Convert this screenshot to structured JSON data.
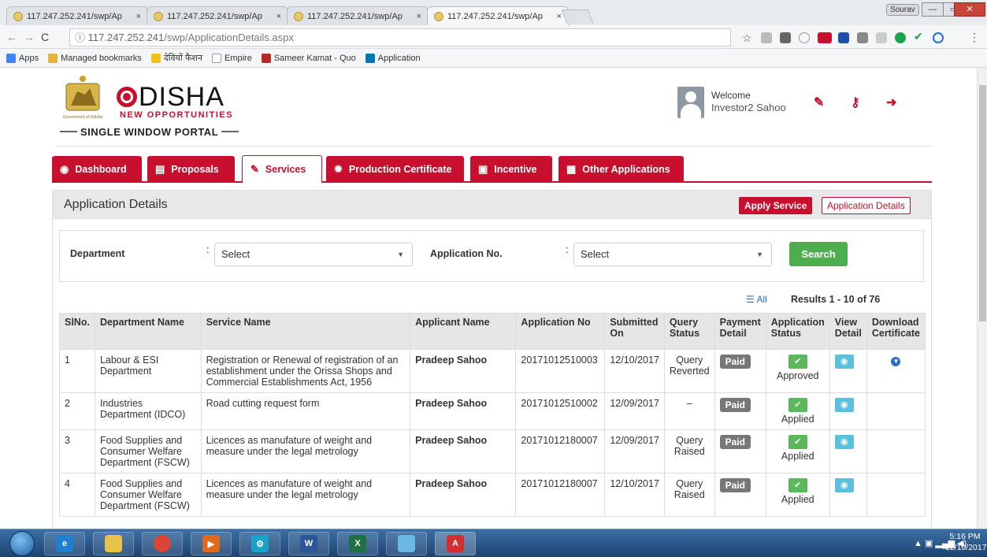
{
  "browser": {
    "tabs": [
      {
        "title": "117.247.252.241/swp/Ap",
        "close": "×"
      },
      {
        "title": "117.247.252.241/swp/Ap",
        "close": "×"
      },
      {
        "title": "117.247.252.241/swp/Ap",
        "close": "×"
      },
      {
        "title": "117.247.252.241/swp/Ap",
        "close": "×"
      }
    ],
    "user_chip": "Sourav",
    "window_controls": {
      "minimize": "—",
      "maximize": "▭",
      "close": "✕"
    },
    "url_prefix": "117.247.252.241",
    "url_path": "/swp/ApplicationDetails.aspx",
    "bookmarks": [
      {
        "label": "Apps",
        "icon": "apps-grid-icon",
        "color": "#4285f4"
      },
      {
        "label": "Managed bookmarks",
        "icon": "folder-icon",
        "color": "#e8b33c"
      },
      {
        "label": "देवियों फैशन",
        "icon": "fashion-icon",
        "color": "#f2c21b"
      },
      {
        "label": "Empire",
        "icon": "page-icon",
        "color": "#cccccc"
      },
      {
        "label": "Sameer Kamat - Quo",
        "icon": "quora-icon",
        "color": "#b92b27"
      },
      {
        "label": "Application",
        "icon": "linkedin-icon",
        "color": "#0077b5"
      }
    ]
  },
  "header": {
    "emblem_caption": "Government of Odisha",
    "logo_text": "DISHA",
    "logo_sub": "NEW OPPORTUNITIES",
    "portal": "SINGLE WINDOW PORTAL",
    "welcome": "Welcome",
    "user_name": "Investor2 Sahoo"
  },
  "nav": {
    "tabs": [
      {
        "label": "Dashboard",
        "icon": "dashboard-icon",
        "glyph": "◉"
      },
      {
        "label": "Proposals",
        "icon": "briefcase-icon",
        "glyph": "▤"
      },
      {
        "label": "Services",
        "icon": "wrench-icon",
        "glyph": "✎"
      },
      {
        "label": "Production Certificate",
        "icon": "certificate-icon",
        "glyph": "✹"
      },
      {
        "label": "Incentive",
        "icon": "money-icon",
        "glyph": "▣"
      },
      {
        "label": "Other Applications",
        "icon": "grid-icon",
        "glyph": "▦"
      }
    ]
  },
  "panel": {
    "title": "Application Details",
    "apply_service": "Apply Service",
    "application_details": "Application Details"
  },
  "filters": {
    "department_label": "Department",
    "department_value": "Select",
    "appno_label": "Application No.",
    "appno_value": "Select",
    "colon": ":",
    "search_label": "Search",
    "all_label": "All",
    "results": "Results 1 - 10 of 76"
  },
  "table": {
    "headers": [
      "SlNo.",
      "Department Name",
      "Service Name",
      "Applicant Name",
      "Application No",
      "Submitted On",
      "Query Status",
      "Payment Detail",
      "Application Status",
      "View Detail",
      "Download Certificate"
    ],
    "rows": [
      {
        "sl": "1",
        "dept": "Labour & ESI Department",
        "service": "Registration or Renewal of registration of an establishment under the Orissa Shops and Commercial Establishments Act, 1956",
        "applicant": "Pradeep Sahoo",
        "appno": "20171012510003",
        "submitted": "12/10/2017",
        "query": "Query Reverted",
        "payment": "Paid",
        "status": "Approved",
        "has_download": true
      },
      {
        "sl": "2",
        "dept": "Industries Department (IDCO)",
        "service": "Road cutting request form",
        "applicant": "Pradeep Sahoo",
        "appno": "20171012510002",
        "submitted": "12/09/2017",
        "query": "–",
        "payment": "Paid",
        "status": "Applied",
        "has_download": false
      },
      {
        "sl": "3",
        "dept": "Food Supplies and Consumer Welfare Department (FSCW)",
        "service": "Licences as manufature of weight and measure under the legal metrology",
        "applicant": "Pradeep Sahoo",
        "appno": "20171012180007",
        "submitted": "12/09/2017",
        "query": "Query Raised",
        "payment": "Paid",
        "status": "Applied",
        "has_download": false
      },
      {
        "sl": "4",
        "dept": "Food Supplies and Consumer Welfare Department (FSCW)",
        "service": "Licences as manufature of weight and measure under the legal metrology",
        "applicant": "Pradeep Sahoo",
        "appno": "20171012180007",
        "submitted": "12/10/2017",
        "query": "Query Raised",
        "payment": "Paid",
        "status": "Applied",
        "has_download": false
      }
    ]
  },
  "taskbar": {
    "time": "5:16 PM",
    "date": "12/10/2017",
    "apps": [
      {
        "name": "internet-explorer-icon",
        "label": "e",
        "color": "#1f7fd1"
      },
      {
        "name": "file-explorer-icon",
        "label": "",
        "color": "#e9c24b"
      },
      {
        "name": "chrome-icon",
        "label": "",
        "color": "#db4437"
      },
      {
        "name": "media-player-icon",
        "label": "▶",
        "color": "#e06a1b"
      },
      {
        "name": "network-app-icon",
        "label": "⚙",
        "color": "#1aa3c9"
      },
      {
        "name": "word-icon",
        "label": "W",
        "color": "#2b5797"
      },
      {
        "name": "excel-icon",
        "label": "X",
        "color": "#1e7145"
      },
      {
        "name": "notes-icon",
        "label": "",
        "color": "#6bb7e6"
      },
      {
        "name": "acrobat-icon",
        "label": "A",
        "color": "#d32f2f"
      }
    ]
  },
  "colors": {
    "brand": "#c8102e",
    "link": "#2a6fc9",
    "success": "#5cb85c",
    "info": "#5bc0de",
    "search": "#4cae4c"
  }
}
